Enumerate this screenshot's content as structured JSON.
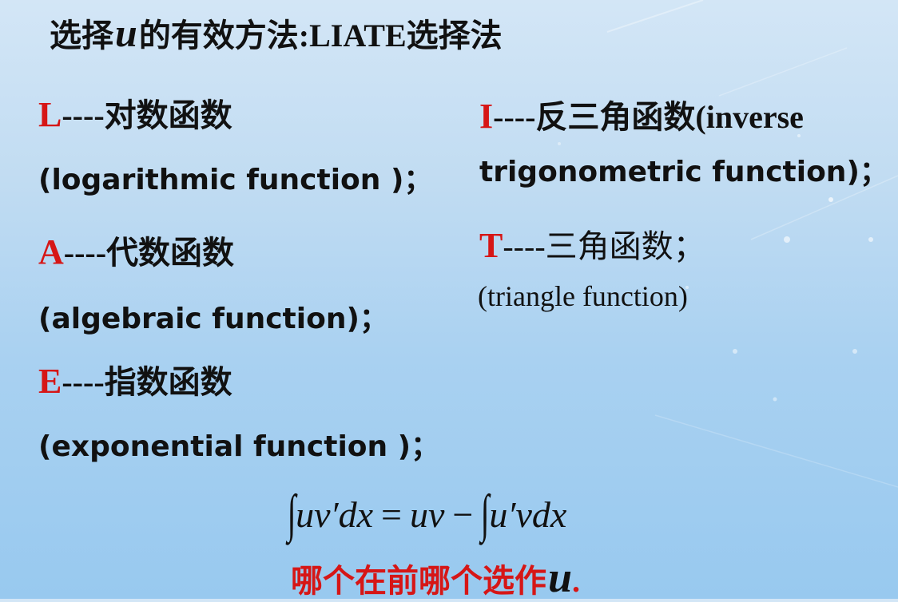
{
  "title": {
    "prefix": "选择",
    "variable": "u",
    "suffix": "的有效方法:LIATE选择法"
  },
  "items": [
    {
      "letter": "L",
      "rest": "----对数函数",
      "sub": "(logarithmic function )；"
    },
    {
      "letter": "A",
      "rest": "----代数函数",
      "sub": "(algebraic function)；"
    },
    {
      "letter": "E",
      "rest": "----指数函数",
      "sub": "(exponential function )；"
    },
    {
      "letter": "I",
      "rest": "----反三角函数(inverse",
      "sub": "trigonometric function)；"
    },
    {
      "letter": "T",
      "rest": "----三角函数；",
      "sub": "(triangle function)"
    }
  ],
  "formula": {
    "integral": "∫",
    "lhs": "uv′dx",
    "eq": "=",
    "uv": "uv",
    "minus": "−",
    "integral2": "∫",
    "rhs": "u′vdx"
  },
  "conclusion": {
    "text": "哪个在前哪个选作",
    "variable": "u",
    "period": "."
  },
  "colors": {
    "accent": "#d61616",
    "text": "#111111",
    "background": "#b9d8f2"
  }
}
